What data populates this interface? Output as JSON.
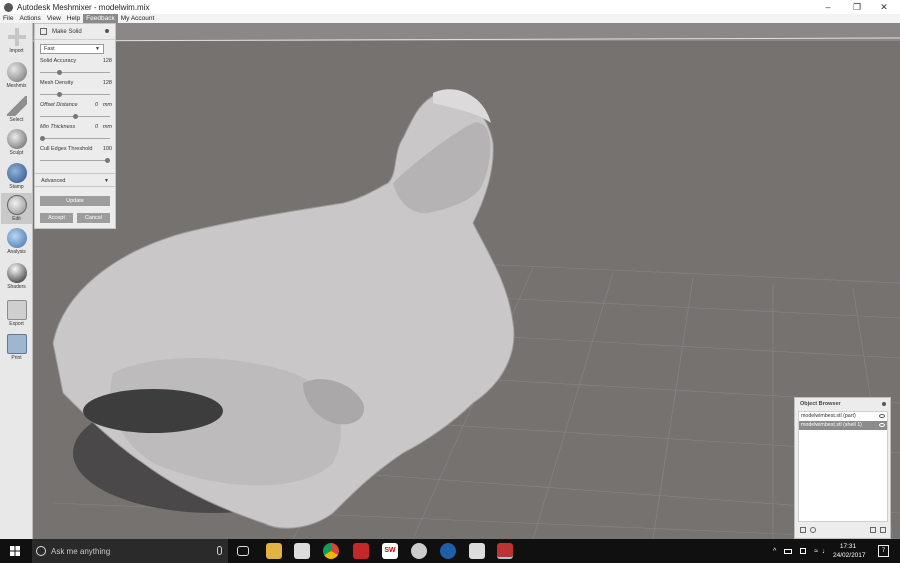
{
  "window": {
    "title": "Autodesk Meshmixer - modelwim.mix"
  },
  "menu": [
    "File",
    "Actions",
    "View",
    "Help",
    "Feedback",
    "My Account"
  ],
  "menu_active": "Feedback",
  "toolbar": [
    {
      "label": "Import",
      "icon": "plus-icon"
    },
    {
      "label": "Meshmix",
      "icon": "meshmix-sphere-icon"
    },
    {
      "label": "Select",
      "icon": "select-arrow-icon"
    },
    {
      "label": "Sculpt",
      "icon": "sculpt-brush-icon"
    },
    {
      "label": "Stamp",
      "icon": "stamp-icon"
    },
    {
      "label": "Edit",
      "icon": "edit-icon"
    },
    {
      "label": "Analysis",
      "icon": "analysis-icon"
    },
    {
      "label": "Shaders",
      "icon": "shaders-icon"
    },
    {
      "label": "Export",
      "icon": "export-icon"
    },
    {
      "label": "Print",
      "icon": "print-icon"
    }
  ],
  "panel": {
    "title": "Make Solid",
    "mode": "Fast",
    "params": [
      {
        "label": "Solid Accuracy",
        "value": "128",
        "unit": "",
        "level": 0.26
      },
      {
        "label": "Mesh Density",
        "value": "128",
        "unit": "",
        "level": 0.26
      },
      {
        "label": "Offset Distance",
        "value": "0",
        "unit": "mm",
        "level": 0.5
      },
      {
        "label": "Min Thickness",
        "value": "0",
        "unit": "mm",
        "level": 0.0
      },
      {
        "label": "Cull Edges Threshold",
        "value": "100",
        "unit": "",
        "level": 1.0
      }
    ],
    "advanced": "Advanced",
    "update": "Update",
    "accept": "Accept",
    "cancel": "Cancel"
  },
  "object_browser": {
    "title": "Object Browser",
    "items": [
      {
        "name": "modelwimbest.stl (part)",
        "selected": false
      },
      {
        "name": "modelwimbest.stl (shell 1)",
        "selected": true
      }
    ]
  },
  "taskbar": {
    "search_placeholder": "Ask me anything",
    "time": "17:31",
    "date": "24/02/2017",
    "notifications": "7"
  },
  "colors": {
    "viewport": "#767270",
    "accent": "#8c8c8c",
    "mesh": "#c8c6c6"
  }
}
